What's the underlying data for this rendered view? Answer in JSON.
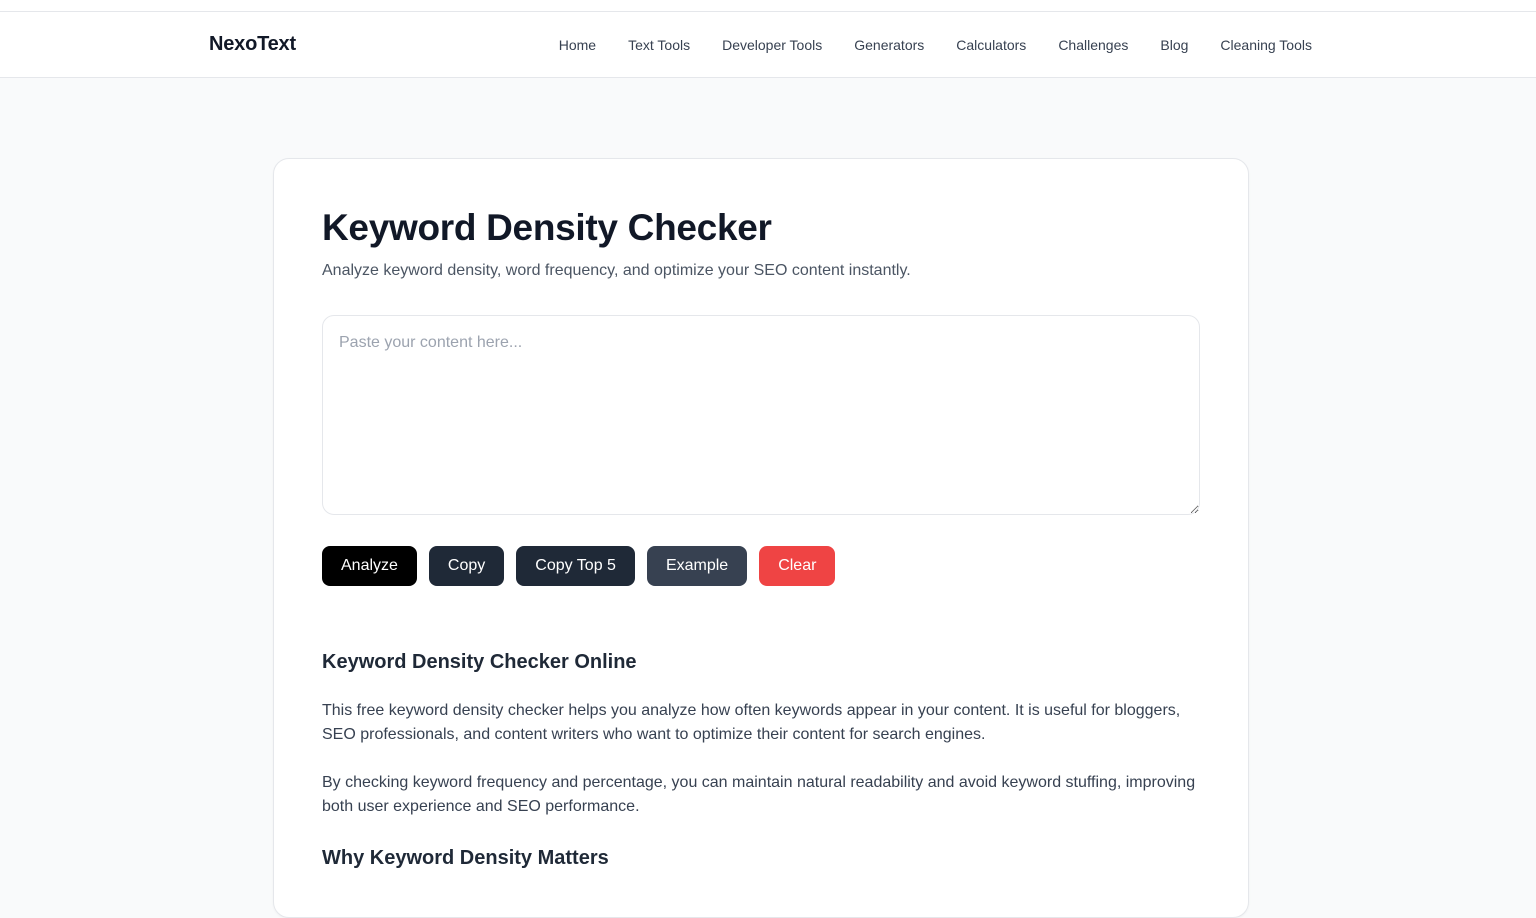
{
  "header": {
    "brand": "NexoText",
    "nav": [
      "Home",
      "Text Tools",
      "Developer Tools",
      "Generators",
      "Calculators",
      "Challenges",
      "Blog",
      "Cleaning Tools"
    ]
  },
  "tool": {
    "title": "Keyword Density Checker",
    "subtitle": "Analyze keyword density, word frequency, and optimize your SEO content instantly.",
    "input_placeholder": "Paste your content here...",
    "input_value": "",
    "buttons": {
      "analyze": {
        "label": "Analyze",
        "color": "#000000"
      },
      "copy": {
        "label": "Copy",
        "color": "#1f2937"
      },
      "copy_top5": {
        "label": "Copy Top 5",
        "color": "#1f2937"
      },
      "example": {
        "label": "Example",
        "color": "#374151"
      },
      "clear": {
        "label": "Clear",
        "color": "#ef4444"
      }
    }
  },
  "article": {
    "heading": "Keyword Density Checker Online",
    "paragraphs": [
      "This free keyword density checker helps you analyze how often keywords appear in your content. It is useful for bloggers, SEO professionals, and content writers who want to optimize their content for search engines.",
      "By checking keyword frequency and percentage, you can maintain natural readability and avoid keyword stuffing, improving both user experience and SEO performance."
    ],
    "subheading": "Why Keyword Density Matters"
  }
}
